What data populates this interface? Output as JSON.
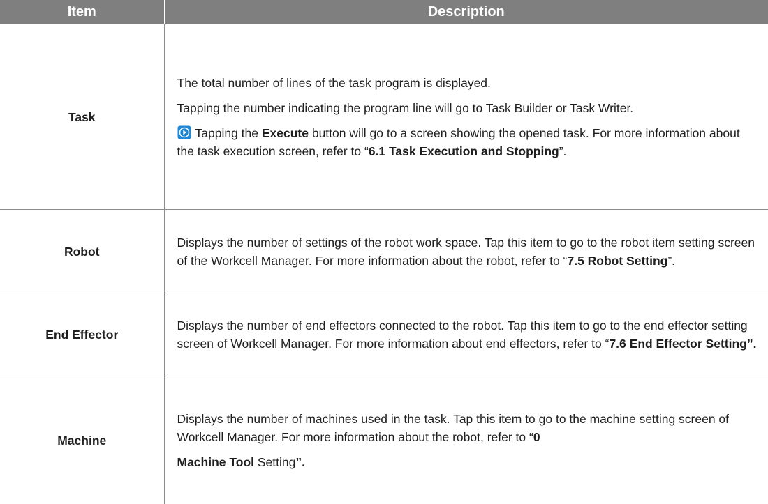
{
  "header": {
    "item": "Item",
    "description": "Description"
  },
  "rows": {
    "task": {
      "item": "Task",
      "p1": "The total number of lines of the task program is displayed.",
      "p2": "Tapping the number indicating the program line will go to Task Builder or Task Writer.",
      "p3_a": "Tapping the ",
      "p3_b": "Execute",
      "p3_c": " button will go to a screen showing the opened task. For more information about the task execution screen, refer to “",
      "p3_d": "6.1 Task Execution and Stopping",
      "p3_e": "”.",
      "icon": "execute-play-icon"
    },
    "robot": {
      "item": "Robot",
      "a": "Displays the number of settings of the robot work space. Tap this item to go to the robot item setting screen of the Workcell Manager. For more information about the robot, refer to “",
      "b": "7.5 Robot Setting",
      "c": "”."
    },
    "end_effector": {
      "item": "End Effector",
      "a": "Displays the number of end effectors connected to the robot. Tap this item to go to the end effector setting screen of Workcell Manager. For more information about end effectors, refer to “",
      "b": "7.6 End Effector Setting”."
    },
    "machine": {
      "item": "Machine",
      "a": "Displays the number of machines used in the task. Tap this item to go to the machine setting screen of Workcell Manager. For more information about the robot, refer to “",
      "b": "0",
      "c": "Machine Tool",
      "d": " Setting",
      "e": "”."
    }
  },
  "colors": {
    "header_bg": "#7f7f7f",
    "header_text": "#ffffff",
    "icon_blue": "#1e88d6"
  }
}
